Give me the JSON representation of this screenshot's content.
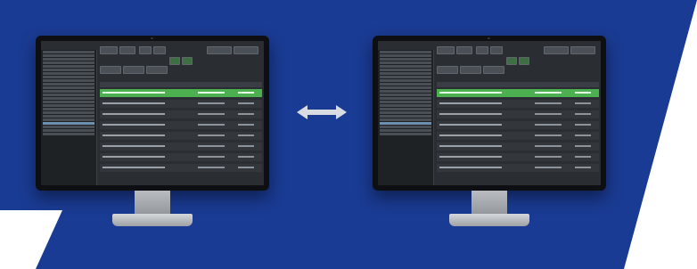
{
  "scene": {
    "background_colors": {
      "blue": "#1a3b93",
      "white": "#ffffff"
    },
    "arrow_icon": "double-arrow-icon"
  },
  "monitors": [
    {
      "id": "left-monitor",
      "app_title": ""
    },
    {
      "id": "right-monitor",
      "app_title": ""
    }
  ]
}
